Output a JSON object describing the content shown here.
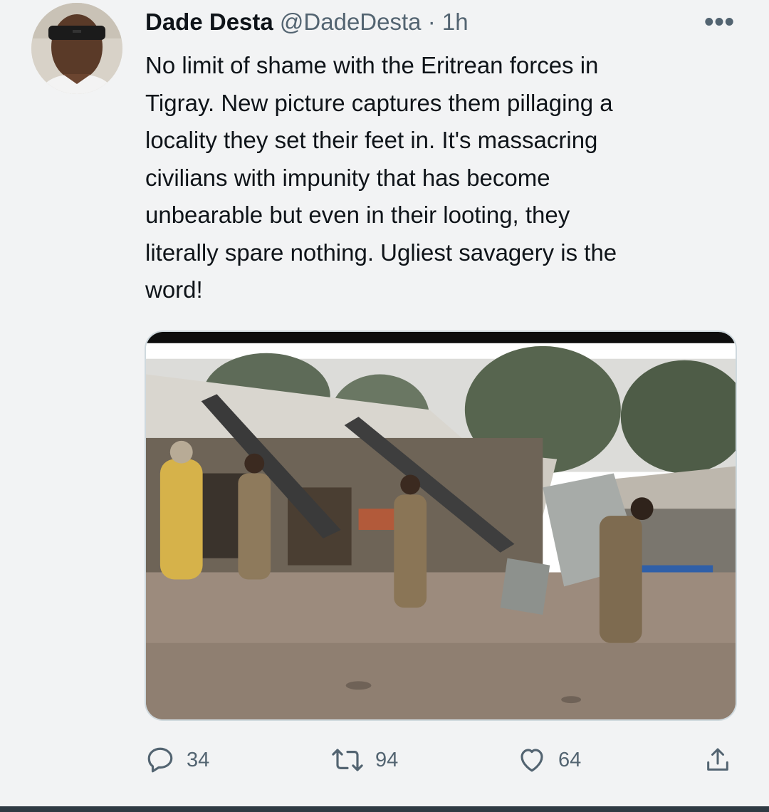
{
  "tweet": {
    "display_name": "Dade Desta",
    "handle": "@DadeDesta",
    "separator": "·",
    "time": "1h",
    "more_label": "•••",
    "text": "No limit of shame with the Eritrean forces in\nTigray. New picture captures them pillaging a\nlocality they set their feet in. It's massacring\ncivilians with impunity that has become\nunbearable but even in their looting, they\nliterally spare nothing. Ugliest savagery is the\nword!",
    "media": {
      "type": "photo"
    }
  },
  "actions": {
    "replies": "34",
    "retweets": "94",
    "likes": "64"
  },
  "icons": {
    "reply": "reply-icon",
    "retweet": "retweet-icon",
    "like": "heart-icon",
    "share": "share-icon",
    "more": "more-icon"
  }
}
